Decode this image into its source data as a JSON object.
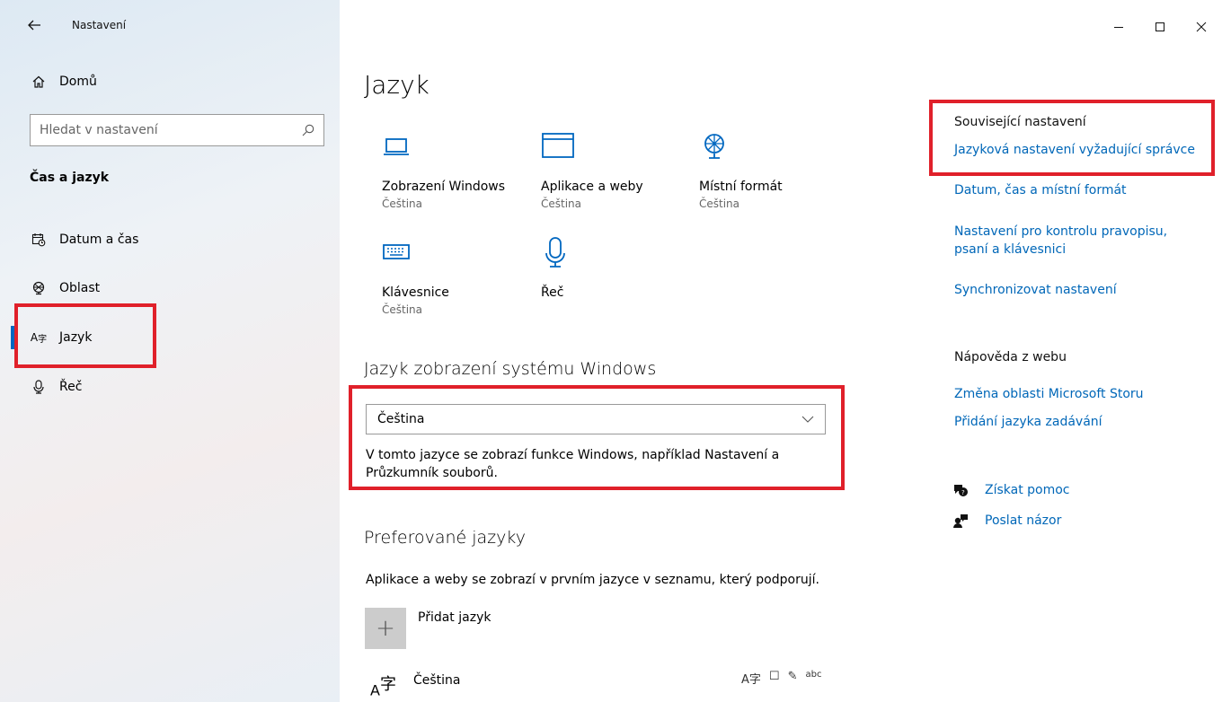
{
  "window": {
    "title": "Nastavení",
    "controls": {
      "minimize": "–",
      "maximize": "☐",
      "close": "✕"
    }
  },
  "sidebar": {
    "home_label": "Domů",
    "search_placeholder": "Hledat v nastavení",
    "section_title": "Čas a jazyk",
    "items": [
      {
        "label": "Datum a čas",
        "icon": "calendar-clock-icon"
      },
      {
        "label": "Oblast",
        "icon": "globe-region-icon"
      },
      {
        "label": "Jazyk",
        "icon": "language-icon",
        "active": true
      },
      {
        "label": "Řeč",
        "icon": "microphone-icon"
      }
    ]
  },
  "main": {
    "title": "Jazyk",
    "tiles": [
      {
        "label": "Zobrazení Windows",
        "sub": "Čeština",
        "icon": "laptop-icon"
      },
      {
        "label": "Aplikace a weby",
        "sub": "Čeština",
        "icon": "browser-window-icon"
      },
      {
        "label": "Místní formát",
        "sub": "Čeština",
        "icon": "globe-format-icon"
      },
      {
        "label": "Klávesnice",
        "sub": "Čeština",
        "icon": "keyboard-icon"
      },
      {
        "label": "Řeč",
        "sub": "",
        "icon": "microphone-icon"
      }
    ],
    "display_lang_heading": "Jazyk zobrazení systému Windows",
    "display_lang_value": "Čeština",
    "display_lang_desc": "V tomto jazyce se zobrazí funkce Windows, například Nastavení a Průzkumník souborů.",
    "preferred_heading": "Preferované jazyky",
    "preferred_desc": "Aplikace a weby se zobrazí v prvním jazyce v seznamu, který podporují.",
    "add_lang_label": "Přidat jazyk",
    "languages": [
      {
        "name": "Čeština",
        "features": [
          "A字",
          "☐",
          "✎",
          "abc"
        ]
      }
    ]
  },
  "related": {
    "heading": "Související nastavení",
    "links": [
      "Jazyková nastavení vyžadující správce",
      "Datum, čas a místní formát",
      "Nastavení pro kontrolu pravopisu, psaní a klávesnici",
      "Synchronizovat nastavení"
    ]
  },
  "web_help": {
    "heading": "Nápověda z webu",
    "links": [
      "Změna oblasti Microsoft Storu",
      "Přidání jazyka zadávání"
    ]
  },
  "help": {
    "get_help": "Získat pomoc",
    "feedback": "Poslat názor"
  },
  "colors": {
    "accent": "#0067c0",
    "link": "#0067b8",
    "highlight": "#e0202a"
  }
}
